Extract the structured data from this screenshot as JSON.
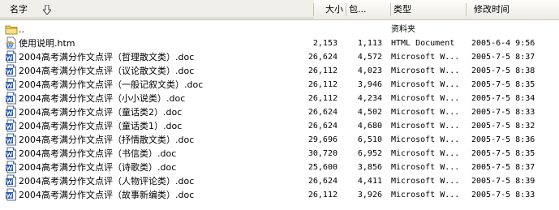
{
  "columns": {
    "name": "名字",
    "size": "大小",
    "packed": "包...",
    "type": "类型",
    "modified": "修改时间"
  },
  "sort_icon": "sort-down-arrow-icon",
  "rows": [
    {
      "icon": "folder-up-icon",
      "name": "..",
      "size": "",
      "packed": "",
      "type": "资料夹",
      "modified": ""
    },
    {
      "icon": "html-document-icon",
      "name": "使用说明.htm",
      "size": "2,153",
      "packed": "1,113",
      "type": "HTML Document",
      "modified": "2005-6-4 9:56"
    },
    {
      "icon": "word-document-icon",
      "name": "2004高考满分作文点评（哲理散文类）.doc",
      "size": "26,624",
      "packed": "4,572",
      "type": "Microsoft W...",
      "modified": "2005-7-5 8:37"
    },
    {
      "icon": "word-document-icon",
      "name": "2004高考满分作文点评（议论散文类）.doc",
      "size": "26,112",
      "packed": "4,023",
      "type": "Microsoft W...",
      "modified": "2005-7-5 8:38"
    },
    {
      "icon": "word-document-icon",
      "name": "2004高考满分作文点评（一般记叙文类）.doc",
      "size": "26,112",
      "packed": "3,946",
      "type": "Microsoft W...",
      "modified": "2005-7-5 8:35"
    },
    {
      "icon": "word-document-icon",
      "name": "2004高考满分作文点评（小小说类）.doc",
      "size": "26,112",
      "packed": "4,234",
      "type": "Microsoft W...",
      "modified": "2005-7-5 8:34"
    },
    {
      "icon": "word-document-icon",
      "name": "2004高考满分作文点评（童话类2）.doc",
      "size": "26,624",
      "packed": "4,502",
      "type": "Microsoft W...",
      "modified": "2005-7-5 8:33"
    },
    {
      "icon": "word-document-icon",
      "name": "2004高考满分作文点评（童话类1）.doc",
      "size": "26,624",
      "packed": "4,680",
      "type": "Microsoft W...",
      "modified": "2005-7-5 8:32"
    },
    {
      "icon": "word-document-icon",
      "name": "2004高考满分作文点评（抒情散文类）.doc",
      "size": "29,696",
      "packed": "6,510",
      "type": "Microsoft W...",
      "modified": "2005-7-5 8:36"
    },
    {
      "icon": "word-document-icon",
      "name": "2004高考满分作文点评（书信类）.doc",
      "size": "30,720",
      "packed": "6,952",
      "type": "Microsoft W...",
      "modified": "2005-7-5 8:35"
    },
    {
      "icon": "word-document-icon",
      "name": "2004高考满分作文点评（诗歌类）.doc",
      "size": "25,600",
      "packed": "3,856",
      "type": "Microsoft W...",
      "modified": "2005-7-5 8:37"
    },
    {
      "icon": "word-document-icon",
      "name": "2004高考满分作文点评（人物评论类）.doc",
      "size": "26,624",
      "packed": "4,411",
      "type": "Microsoft W...",
      "modified": "2005-7-5 8:39"
    },
    {
      "icon": "word-document-icon",
      "name": "2004高考满分作文点评（故事新编类）.doc",
      "size": "26,112",
      "packed": "3,926",
      "type": "Microsoft W...",
      "modified": "2005-7-5 8:33"
    }
  ]
}
